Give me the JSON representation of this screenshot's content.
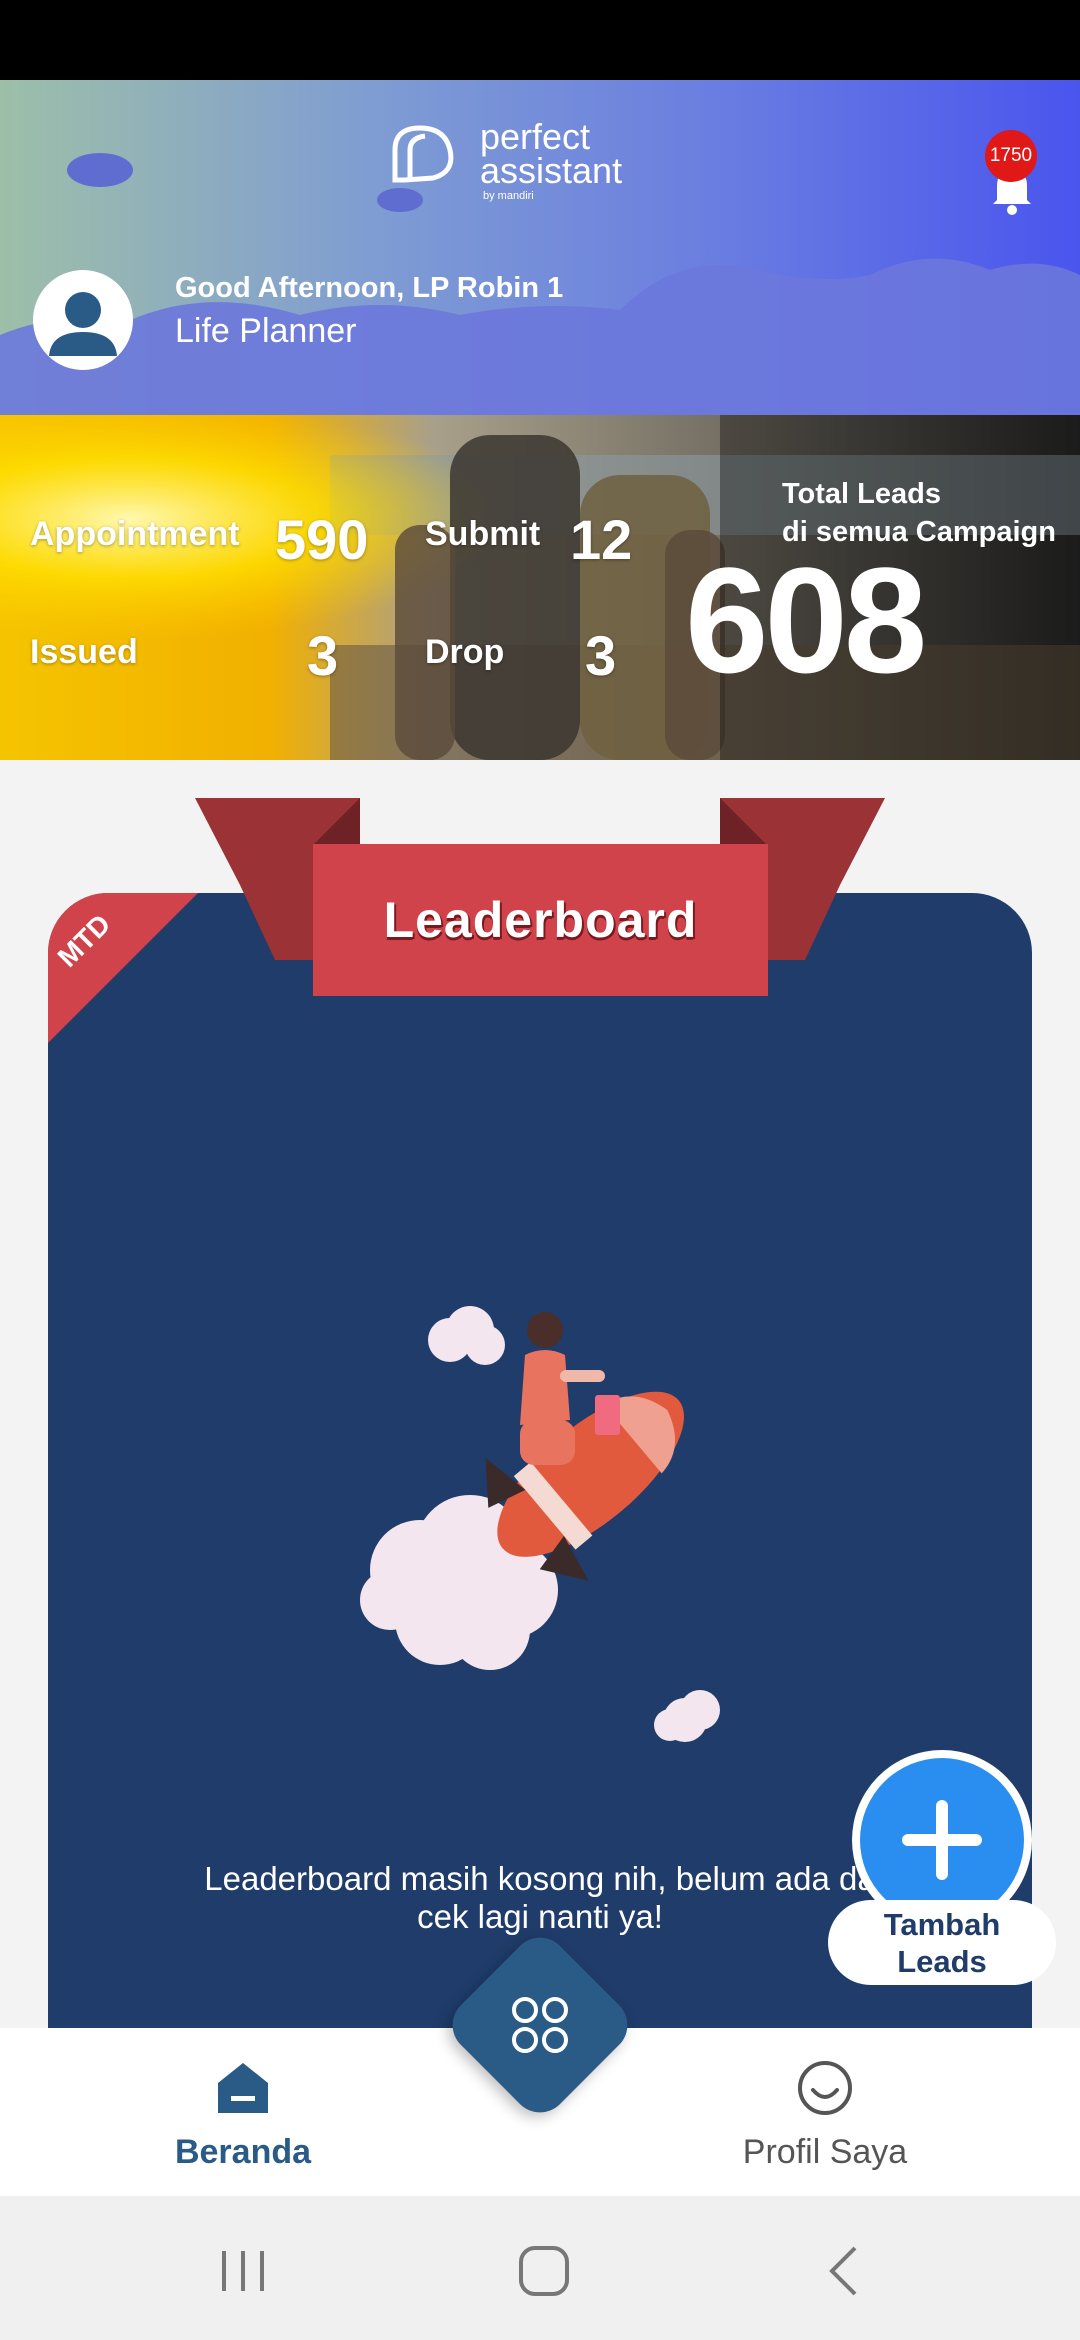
{
  "header": {
    "logo_line1": "perfect",
    "logo_line2": "assistant",
    "logo_sub": "by mandiri",
    "notification_count": "1750",
    "greeting": "Good Afternoon, LP Robin 1",
    "role": "Life Planner"
  },
  "stats": {
    "appointment_label": "Appointment",
    "appointment_value": "590",
    "submit_label": "Submit",
    "submit_value": "12",
    "issued_label": "Issued",
    "issued_value": "3",
    "drop_label": "Drop",
    "drop_value": "3",
    "total_label_1": "Total Leads",
    "total_label_2": "di semua Campaign",
    "total_value": "608"
  },
  "leaderboard": {
    "title": "Leaderboard",
    "period_badge": "MTD",
    "empty_message_1": "Leaderboard masih kosong nih, belum ada da",
    "empty_message_2": "cek lagi nanti ya!"
  },
  "fab": {
    "label_line1": "Tambah",
    "label_line2": "Leads"
  },
  "nav": {
    "home_label": "Beranda",
    "profile_label": "Profil Saya"
  },
  "colors": {
    "brand_navy": "#1f3c6a",
    "ribbon_red": "#d1434b",
    "fab_blue": "#2a8ef0",
    "nav_active": "#2a5a86"
  }
}
